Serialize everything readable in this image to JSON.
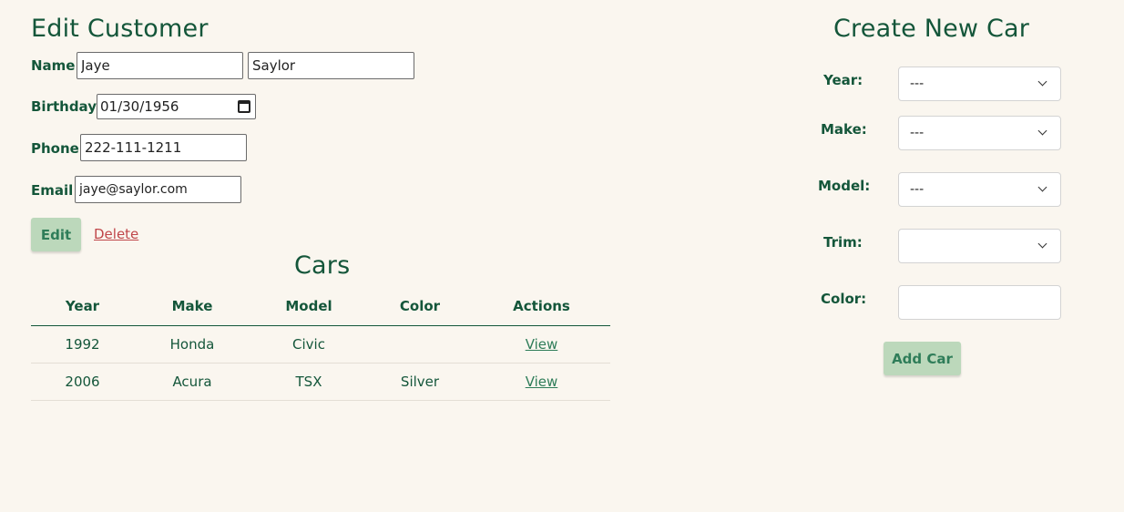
{
  "edit_customer": {
    "title": "Edit Customer",
    "name_label": "Name:",
    "first_name": "Jaye",
    "last_name": "Saylor",
    "birthday_label": "Birthday:",
    "birthday": "01/30/1956",
    "phone_label": "Phone",
    "phone": "222-111-1211",
    "email_label": "Email",
    "email": "jaye@saylor.com",
    "colon": ":",
    "edit_button": "Edit",
    "delete_link": "Delete"
  },
  "cars": {
    "title": "Cars",
    "headers": [
      "Year",
      "Make",
      "Model",
      "Color",
      "Actions"
    ],
    "rows": [
      {
        "year": "1992",
        "make": "Honda",
        "model": "Civic",
        "color": "",
        "action": "View"
      },
      {
        "year": "2006",
        "make": "Acura",
        "model": "TSX",
        "color": "Silver",
        "action": "View"
      }
    ]
  },
  "create_car": {
    "title": "Create New Car",
    "year_label": "Year:",
    "year_value": "---",
    "make_label": "Make:",
    "make_value": "---",
    "model_label": "Model:",
    "model_value": "---",
    "trim_label": "Trim:",
    "trim_value": "",
    "color_label": "Color:",
    "color_value": "",
    "add_button": "Add Car"
  },
  "colors": {
    "background": "#faf6ef",
    "primary_text": "#14563a",
    "button_bg": "#bcd8bb",
    "delete_link": "#c0464a",
    "view_link": "#2f7d59"
  }
}
